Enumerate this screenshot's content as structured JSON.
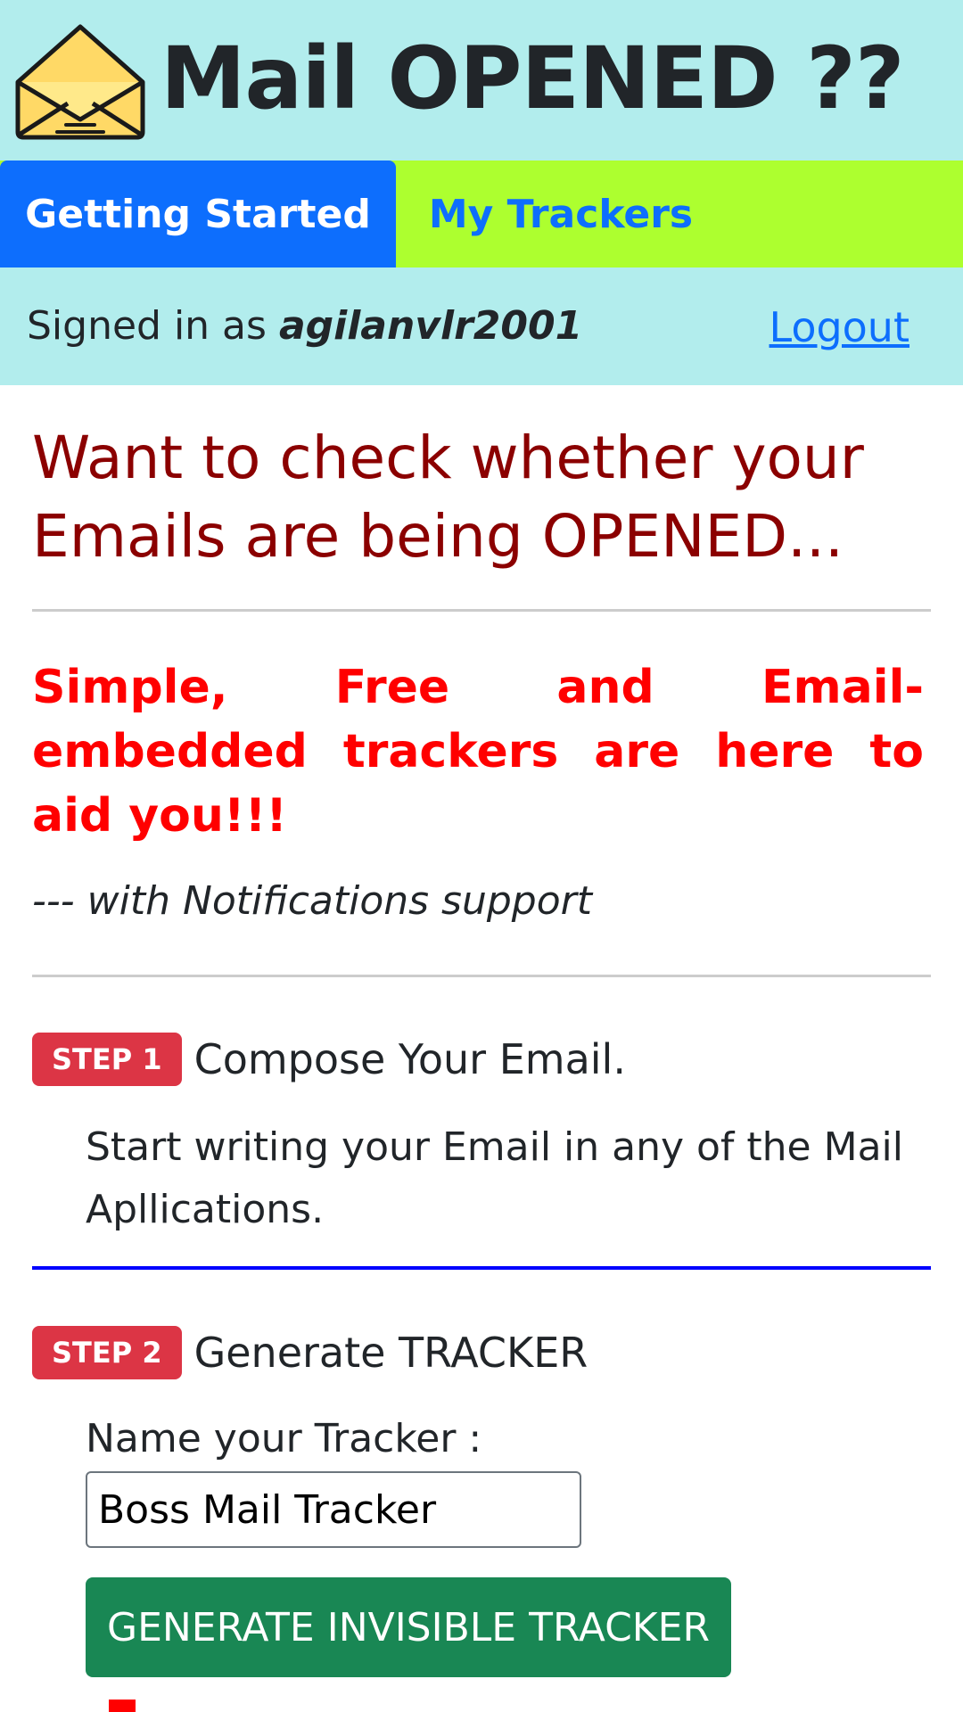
{
  "header": {
    "title": "Mail OPENED ??",
    "logo_icon": "envelope-open-icon"
  },
  "tabs": [
    {
      "label": "Getting Started",
      "active": true
    },
    {
      "label": "My Trackers",
      "active": false
    }
  ],
  "user_bar": {
    "signed_in_prefix": "Signed in as",
    "username": "agilanvlr2001",
    "logout_label": "Logout"
  },
  "main": {
    "headline": "Want to check whether your Emails are being OPENED...",
    "tagline": "Simple, Free and Email-embedded trackers are here to aid you!!!",
    "subtagline": "--- with Notifications support"
  },
  "steps": [
    {
      "badge": "STEP 1",
      "title": "Compose Your Email.",
      "description": "Start writing your Email in any of the Mail Apllications."
    },
    {
      "badge": "STEP 2",
      "title": "Generate TRACKER",
      "field_label": "Name your Tracker :",
      "input_value": "Boss Mail Tracker",
      "button_label": "GENERATE INVISIBLE TRACKER"
    }
  ],
  "colors": {
    "header_bg": "#b2eded",
    "tab_bar_bg": "#adff2f",
    "tab_active_bg": "#0d6efd",
    "headline": "#8b0000",
    "tagline": "#ff0000",
    "badge": "#dc3545",
    "button": "#198754",
    "divider_blue": "#0000ff"
  }
}
